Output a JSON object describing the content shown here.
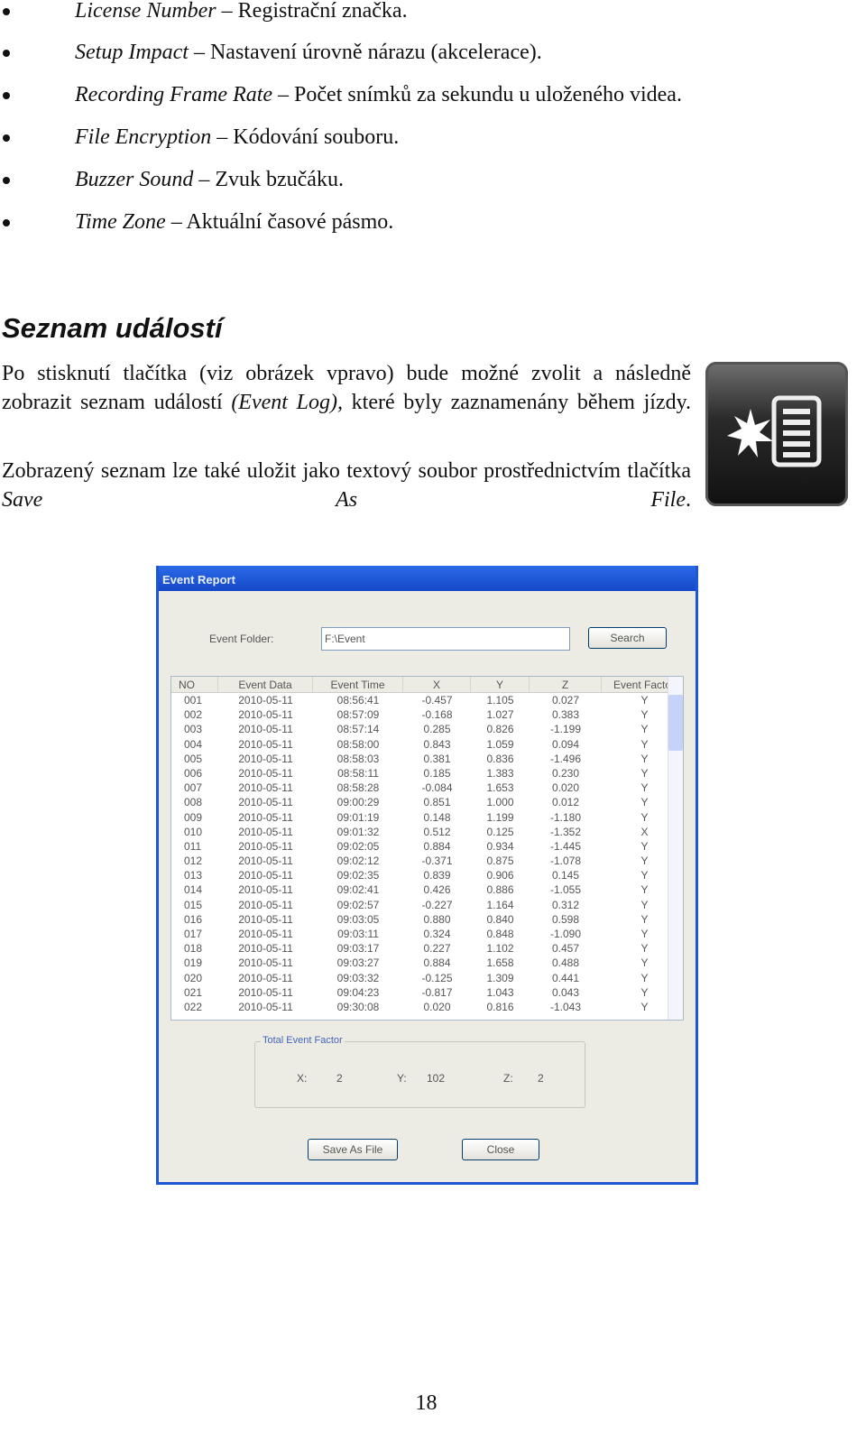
{
  "bullets": [
    {
      "term": "License Number",
      "desc": " – Registrační značka."
    },
    {
      "term": "Setup Impact",
      "desc": " – Nastavení úrovně nárazu (akcelerace)."
    },
    {
      "term": "Recording Frame Rate",
      "desc": " – Počet snímků za sekundu u uloženého videa."
    },
    {
      "term": "File Encryption",
      "desc": " – Kódování souboru."
    },
    {
      "term": "Buzzer Sound",
      "desc": " – Zvuk bzučáku."
    },
    {
      "term": "Time Zone",
      "desc": " – Aktuální časové pásmo."
    }
  ],
  "section": {
    "heading": "Seznam událostí",
    "p1": {
      "a": "Po stisknutí tlačítka (viz obrázek vpravo) bude možné zvolit a následně zobrazit seznam událostí ",
      "i": "(Event Log),",
      "b": " které byly zaznamenány během jízdy."
    },
    "p2": {
      "a": "Zobrazený seznam lze také uložit jako textový soubor prostřednictvím tlačítka ",
      "i": "Save As File",
      "b": "."
    }
  },
  "event_log_icon": "event-log-icon",
  "dialog": {
    "title": "Event Report",
    "folder_label": "Event Folder:",
    "folder_value": "F:\\Event",
    "search_label": "Search",
    "columns": [
      "NO",
      "Event Data",
      "Event Time",
      "X",
      "Y",
      "Z",
      "Event Factor"
    ],
    "rows": [
      [
        "001",
        "2010-05-11",
        "08:56:41",
        "-0.457",
        "1.105",
        "0.027",
        "Y"
      ],
      [
        "002",
        "2010-05-11",
        "08:57:09",
        "-0.168",
        "1.027",
        "0.383",
        "Y"
      ],
      [
        "003",
        "2010-05-11",
        "08:57:14",
        "0.285",
        "0.826",
        "-1.199",
        "Y"
      ],
      [
        "004",
        "2010-05-11",
        "08:58:00",
        "0.843",
        "1.059",
        "0.094",
        "Y"
      ],
      [
        "005",
        "2010-05-11",
        "08:58:03",
        "0.381",
        "0.836",
        "-1.496",
        "Y"
      ],
      [
        "006",
        "2010-05-11",
        "08:58:11",
        "0.185",
        "1.383",
        "0.230",
        "Y"
      ],
      [
        "007",
        "2010-05-11",
        "08:58:28",
        "-0.084",
        "1.653",
        "0.020",
        "Y"
      ],
      [
        "008",
        "2010-05-11",
        "09:00:29",
        "0.851",
        "1.000",
        "0.012",
        "Y"
      ],
      [
        "009",
        "2010-05-11",
        "09:01:19",
        "0.148",
        "1.199",
        "-1.180",
        "Y"
      ],
      [
        "010",
        "2010-05-11",
        "09:01:32",
        "0.512",
        "0.125",
        "-1.352",
        "X"
      ],
      [
        "011",
        "2010-05-11",
        "09:02:05",
        "0.884",
        "0.934",
        "-1.445",
        "Y"
      ],
      [
        "012",
        "2010-05-11",
        "09:02:12",
        "-0.371",
        "0.875",
        "-1.078",
        "Y"
      ],
      [
        "013",
        "2010-05-11",
        "09:02:35",
        "0.839",
        "0.906",
        "0.145",
        "Y"
      ],
      [
        "014",
        "2010-05-11",
        "09:02:41",
        "0.426",
        "0.886",
        "-1.055",
        "Y"
      ],
      [
        "015",
        "2010-05-11",
        "09:02:57",
        "-0.227",
        "1.164",
        "0.312",
        "Y"
      ],
      [
        "016",
        "2010-05-11",
        "09:03:05",
        "0.880",
        "0.840",
        "0.598",
        "Y"
      ],
      [
        "017",
        "2010-05-11",
        "09:03:11",
        "0.324",
        "0.848",
        "-1.090",
        "Y"
      ],
      [
        "018",
        "2010-05-11",
        "09:03:17",
        "0.227",
        "1.102",
        "0.457",
        "Y"
      ],
      [
        "019",
        "2010-05-11",
        "09:03:27",
        "0.884",
        "1.658",
        "0.488",
        "Y"
      ],
      [
        "020",
        "2010-05-11",
        "09:03:32",
        "-0.125",
        "1.309",
        "0.441",
        "Y"
      ],
      [
        "021",
        "2010-05-11",
        "09:04:23",
        "-0.817",
        "1.043",
        "0.043",
        "Y"
      ],
      [
        "022",
        "2010-05-11",
        "09:30:08",
        "0.020",
        "0.816",
        "-1.043",
        "Y"
      ]
    ],
    "total_label": "Total Event Factor",
    "totals": {
      "x_label": "X:",
      "x": "2",
      "y_label": "Y:",
      "y": "102",
      "z_label": "Z:",
      "z": "2"
    },
    "save_label": "Save As File",
    "close_label": "Close"
  },
  "page_number": "18"
}
